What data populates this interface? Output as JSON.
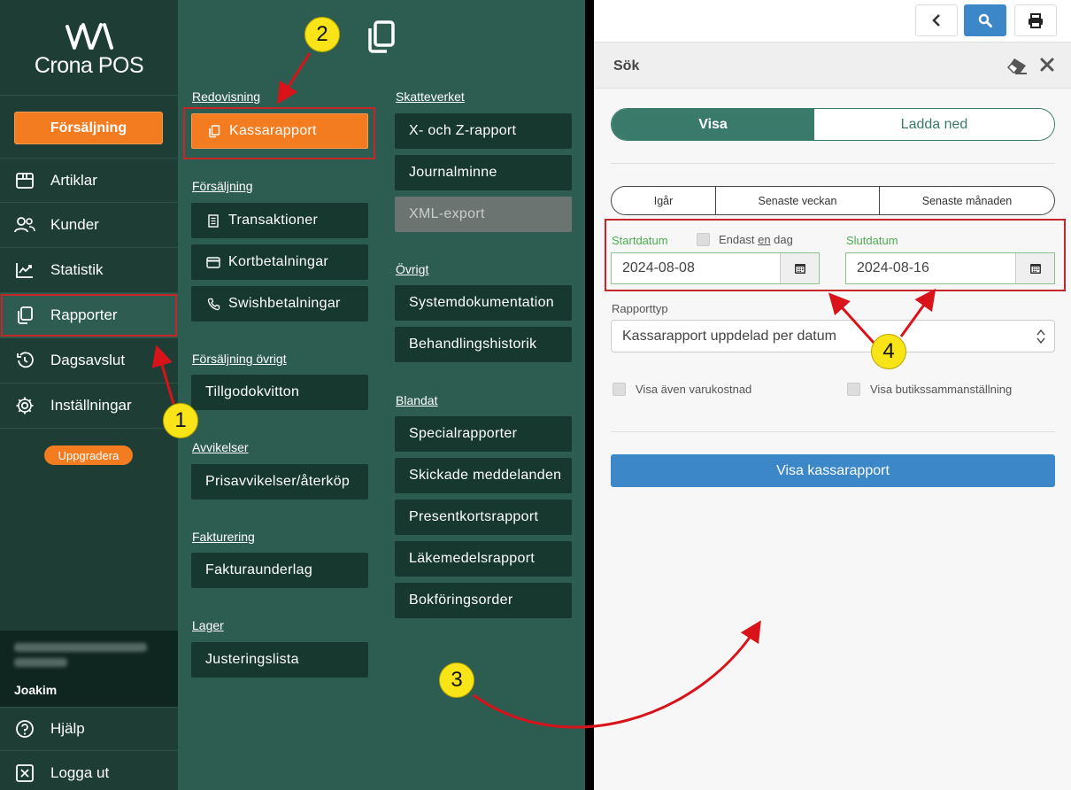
{
  "app": {
    "logo_text": "Crona POS"
  },
  "sidebar": {
    "sale_button": "Försäljning",
    "items": [
      {
        "label": "Artiklar",
        "icon": "box-icon"
      },
      {
        "label": "Kunder",
        "icon": "users-icon"
      },
      {
        "label": "Statistik",
        "icon": "chart-icon"
      },
      {
        "label": "Rapporter",
        "icon": "copy-icon",
        "active": true
      },
      {
        "label": "Dagsavslut",
        "icon": "history-icon"
      },
      {
        "label": "Inställningar",
        "icon": "gear-icon"
      }
    ],
    "upgrade": "Uppgradera",
    "user_name": "Joakim",
    "bottom": [
      {
        "label": "Hjälp",
        "icon": "help-icon"
      },
      {
        "label": "Logga ut",
        "icon": "logout-icon"
      }
    ]
  },
  "menu": {
    "redovisning": {
      "title": "Redovisning",
      "items": [
        "Kassarapport"
      ]
    },
    "forsaljning": {
      "title": "Försäljning",
      "items": [
        "Transaktioner",
        "Kortbetalningar",
        "Swishbetalningar"
      ]
    },
    "forsaljning_ovrigt": {
      "title": "Försäljning övrigt",
      "items": [
        "Tillgodokvitton"
      ]
    },
    "avvikelser": {
      "title": "Avvikelser",
      "items": [
        "Prisavvikelser/återköp"
      ]
    },
    "fakturering": {
      "title": "Fakturering",
      "items": [
        "Fakturaunderlag"
      ]
    },
    "lager": {
      "title": "Lager",
      "items": [
        "Justeringslista"
      ]
    },
    "skatteverket": {
      "title": "Skatteverket",
      "items": [
        "X- och Z-rapport",
        "Journalminne",
        "XML-export"
      ]
    },
    "ovrigt": {
      "title": "Övrigt",
      "items": [
        "Systemdokumentation",
        "Behandlingshistorik"
      ]
    },
    "blandat": {
      "title": "Blandat",
      "items": [
        "Specialrapporter",
        "Skickade meddelanden",
        "Presentkortsrapport",
        "Läkemedelsrapport",
        "Bokföringsorder"
      ]
    }
  },
  "panel": {
    "title": "Sök",
    "tabs": [
      "Visa",
      "Ladda ned"
    ],
    "quick": [
      "Igår",
      "Senaste veckan",
      "Senaste månaden"
    ],
    "start_label": "Startdatum",
    "only_one_day_pre": "Endast ",
    "only_one_day_en": "en",
    "only_one_day_post": " dag",
    "start_value": "2024-08-08",
    "end_label": "Slutdatum",
    "end_value": "2024-08-16",
    "type_label": "Rapporttyp",
    "type_value": "Kassarapport uppdelad per datum",
    "cb_cost": "Visa även varukostnad",
    "cb_store": "Visa butikssammanställning",
    "action": "Visa kassarapport"
  },
  "badges": [
    "1",
    "2",
    "3",
    "4"
  ],
  "colors": {
    "sidebar": "#1e3d34",
    "menu": "#2d5c51",
    "accent": "#f47c20",
    "teal": "#3a7a6a",
    "blue": "#3b87c8",
    "highlight": "#c6262a"
  }
}
